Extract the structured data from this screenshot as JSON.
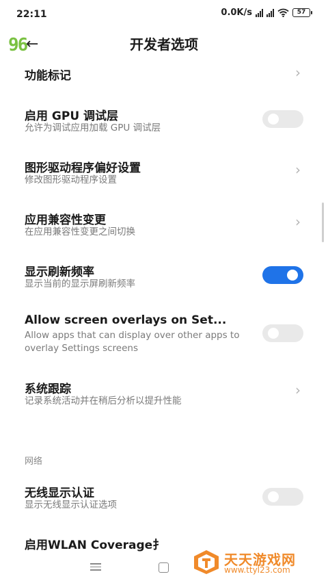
{
  "status_bar": {
    "time": "22:11",
    "network_speed": "0.0K/s",
    "battery": "57",
    "icons": [
      "signal-icon",
      "signal-icon",
      "wifi-icon",
      "battery-icon"
    ]
  },
  "header": {
    "logo_text": "96",
    "back_icon": "back-arrow-icon",
    "title": "开发者选项"
  },
  "rows": [
    {
      "title": "功能标记",
      "subtitle": "",
      "control": "chevron"
    },
    {
      "title": "启用 GPU 调试层",
      "subtitle": "允许为调试应用加载 GPU 调试层",
      "control": "toggle",
      "state": "off"
    },
    {
      "title": "图形驱动程序偏好设置",
      "subtitle": "修改图形驱动程序设置",
      "control": "chevron"
    },
    {
      "title": "应用兼容性变更",
      "subtitle": "在应用兼容性变更之间切换",
      "control": "chevron"
    },
    {
      "title": "显示刷新频率",
      "subtitle": "显示当前的显示屏刷新频率",
      "control": "toggle",
      "state": "on"
    },
    {
      "title": "Allow screen overlays on Set...",
      "subtitle": "Allow apps that can display over other apps to overlay Settings screens",
      "control": "toggle",
      "state": "off"
    },
    {
      "title": "系统跟踪",
      "subtitle": "记录系统活动并在稍后分析以提升性能",
      "control": "chevron"
    }
  ],
  "section_network": {
    "label": "网络",
    "rows": [
      {
        "title": "无线显示认证",
        "subtitle": "显示无线显示认证选项",
        "control": "toggle",
        "state": "off"
      },
      {
        "title": "启用WLAN Coverage扌",
        "subtitle": "",
        "control": "none"
      }
    ]
  },
  "nav_bar": {
    "icons": [
      "menu-icon",
      "home-icon"
    ]
  },
  "watermark": {
    "title": "天天游戏网",
    "url": "www.ttyl23.com"
  },
  "colors": {
    "accent": "#1f73e8",
    "toggle_off": "#e9e9e9",
    "subtitle": "#7a7a7a",
    "watermark": "#f08a2a",
    "logo": "#7ac142"
  }
}
